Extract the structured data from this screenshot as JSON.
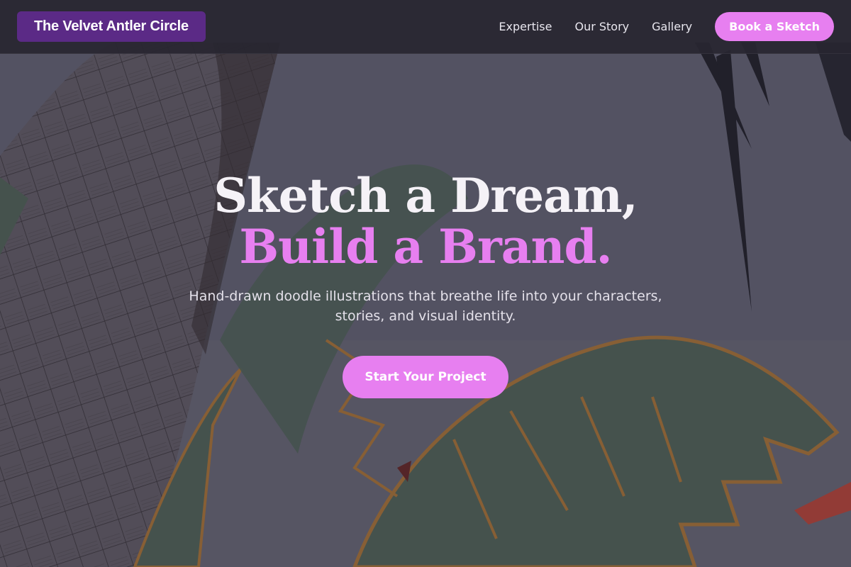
{
  "brand": {
    "name": "The Velvet Antler Circle"
  },
  "nav": {
    "links": [
      {
        "label": "Expertise"
      },
      {
        "label": "Our Story"
      },
      {
        "label": "Gallery"
      }
    ],
    "cta_label": "Book a Sketch"
  },
  "hero": {
    "headline_line1": "Sketch a Dream,",
    "headline_line2": "Build a Brand.",
    "subtitle": "Hand-drawn doodle illustrations that breathe life into your characters, stories, and visual identity.",
    "cta_label": "Start Your Project"
  },
  "colors": {
    "accent": "#e77ff0",
    "brand_badge": "#5b2a86",
    "nav_background": "#28262f",
    "leaf_green": "#55695e",
    "leaf_outline": "#b07a3c"
  }
}
